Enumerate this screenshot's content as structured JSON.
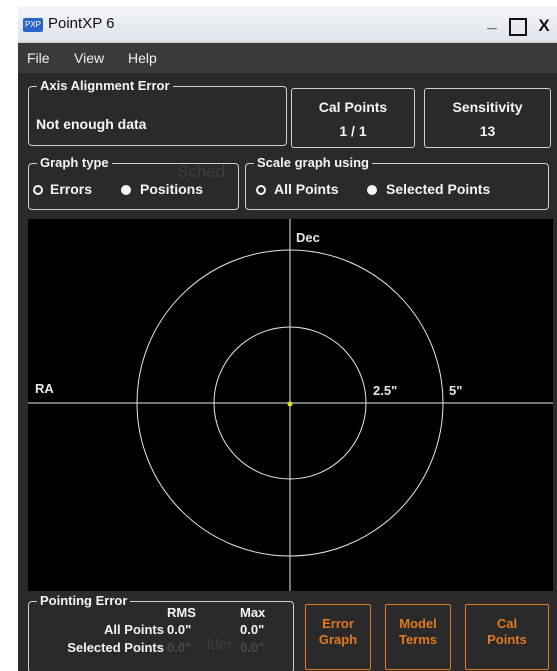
{
  "window": {
    "title": "PointXP 6",
    "icon_text": "PXP",
    "min_label": "_",
    "max_label": "□",
    "close_label": "X"
  },
  "menu": [
    "File",
    "View",
    "Help"
  ],
  "axis_alignment": {
    "legend": "Axis Alignment Error",
    "value": "Not enough data"
  },
  "cal_points": {
    "label": "Cal Points",
    "value": "1 / 1"
  },
  "sensitivity": {
    "label": "Sensitivity",
    "value": "13"
  },
  "graph_type": {
    "legend": "Graph type",
    "options": [
      "Errors",
      "Positions"
    ],
    "selected": "Positions"
  },
  "scale_graph": {
    "legend": "Scale graph using",
    "options": [
      "All Points",
      "Selected Points"
    ],
    "selected": "Selected Points"
  },
  "graph": {
    "axis_x_label": "RA",
    "axis_y_label": "Dec",
    "inner_ring_label": "2.5\"",
    "outer_ring_label": "5\"",
    "line_color": "#e8e8e8",
    "point_color": "#d9e021"
  },
  "pointing_error": {
    "legend": "Pointing Error",
    "col_rms": "RMS",
    "col_max": "Max",
    "rows": [
      {
        "label": "All Points",
        "rms": "0.0\"",
        "max": "0.0\""
      },
      {
        "label": "Selected Points",
        "rms": "0.0\"",
        "max": "0.0\""
      }
    ]
  },
  "bottom_buttons": [
    {
      "line1": "Error",
      "line2": "Graph"
    },
    {
      "line1": "Model",
      "line2": "Terms"
    },
    {
      "line1": "Cal",
      "line2": "Points"
    }
  ],
  "accent_color": "#e07a20",
  "ghost_text": {
    "top": "Sched",
    "bottom": "lder"
  }
}
